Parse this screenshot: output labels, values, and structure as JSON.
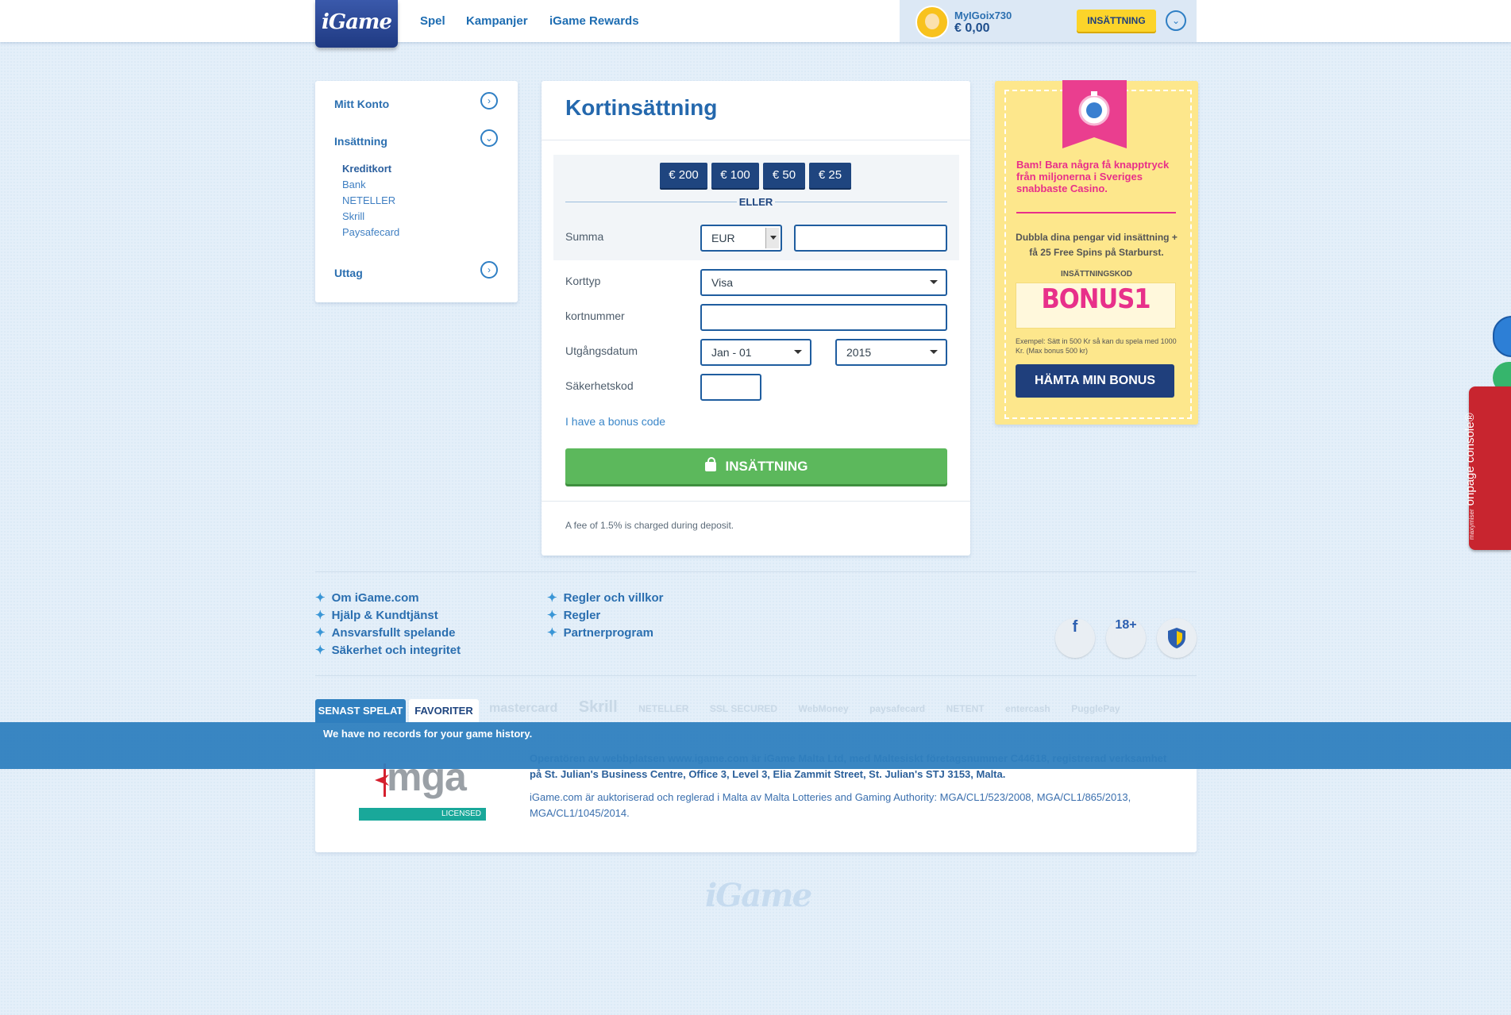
{
  "header": {
    "logo": "iGame",
    "nav": [
      "Spel",
      "Kampanjer",
      "iGame Rewards"
    ],
    "username": "MyIGoix730",
    "balance": "€ 0,00",
    "deposit_button": "INSÄTTNING",
    "expand_icon": "chevron-down-icon"
  },
  "sidebar": {
    "account": "Mitt Konto",
    "deposit": "Insättning",
    "deposit_methods": [
      "Kreditkort",
      "Bank",
      "NETELLER",
      "Skrill",
      "Paysafecard"
    ],
    "withdraw": "Uttag"
  },
  "form": {
    "title": "Kortinsättning",
    "amounts": [
      "€ 200",
      "€ 100",
      "€ 50",
      "€ 25"
    ],
    "or": "ELLER",
    "sum_label": "Summa",
    "currency": "EUR",
    "sum_value": "",
    "card_type_label": "Korttyp",
    "card_type": "Visa",
    "card_number_label": "kortnummer",
    "card_number": "",
    "expiry_label": "Utgångsdatum",
    "expiry_month": "Jan - 01",
    "expiry_year": "2015",
    "cvv_label": "Säkerhetskod",
    "cvv": "",
    "bonus_link": "I have a bonus code",
    "submit": "INSÄTTNING",
    "fee_note": "A fee of 1.5% is charged during deposit."
  },
  "promo": {
    "headline": "Bam! Bara några få knapptryck från miljonerna i Sveriges snabbaste Casino.",
    "offer": "Dubbla dina pengar vid insättning + få 25 Free Spins på Starburst.",
    "code_label": "INSÄTTNINGSKOD",
    "code": "BONUS1",
    "example": "Exempel: Sätt in 500 Kr så kan du spela med 1000 Kr. (Max bonus 500 kr)",
    "button": "HÄMTA MIN BONUS"
  },
  "footer": {
    "links_col1": [
      "Om iGame.com",
      "Hjälp & Kundtjänst",
      "Ansvarsfullt spelande",
      "Säkerhet och integritet"
    ],
    "links_col2": [
      "Regler och villkor",
      "Regler",
      "Partnerprogram"
    ],
    "social": [
      "f",
      "18+"
    ],
    "payment_logos": [
      "mastercard",
      "Skrill",
      "NETELLER",
      "SSL SECURED",
      "WebMoney",
      "paysafecard",
      "NETENT",
      "entercash",
      "PugglePay"
    ],
    "operator_text": "Operatören av webbplatsen www.igame.com är iGame Malta Ltd, med Maltesiskt företagsnummer C44618, registrerad verksamhet på St. Julian's Business Centre, Office 3, Level 3, Elia Zammit Street, St. Julian's STJ 3153, Malta.",
    "license_text": "iGame.com är auktoriserad och reglerad i Malta av Malta Lotteries and Gaming Authority: MGA/CL1/523/2008, MGA/CL1/865/2013, MGA/CL1/1045/2014.",
    "mga_logo": "mga",
    "mga_licensed": "LICENSED",
    "bottom_logo": "iGame"
  },
  "history_bar": {
    "tabs": [
      "SENAST SPELAT",
      "FAVORITER"
    ],
    "message": "We have no records for your game history."
  },
  "widgets": {
    "console_brand": "maxymiser",
    "console_label": "onpage console®"
  }
}
